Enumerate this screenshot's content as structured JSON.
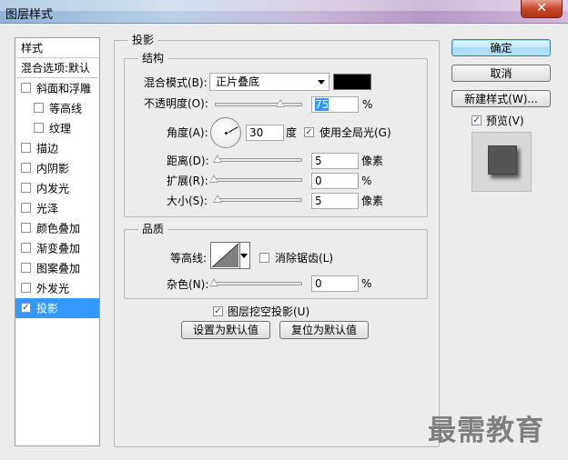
{
  "window": {
    "title": "图层样式",
    "close_glyph": "✕"
  },
  "style_list": {
    "header": "样式",
    "blend_options": "混合选项:默认",
    "items": [
      {
        "label": "斜面和浮雕",
        "checked": false,
        "indent": false
      },
      {
        "label": "等高线",
        "checked": false,
        "indent": true
      },
      {
        "label": "纹理",
        "checked": false,
        "indent": true
      },
      {
        "label": "描边",
        "checked": false,
        "indent": false
      },
      {
        "label": "内阴影",
        "checked": false,
        "indent": false
      },
      {
        "label": "内发光",
        "checked": false,
        "indent": false
      },
      {
        "label": "光泽",
        "checked": false,
        "indent": false
      },
      {
        "label": "颜色叠加",
        "checked": false,
        "indent": false
      },
      {
        "label": "渐变叠加",
        "checked": false,
        "indent": false
      },
      {
        "label": "图案叠加",
        "checked": false,
        "indent": false
      },
      {
        "label": "外发光",
        "checked": false,
        "indent": false
      },
      {
        "label": "投影",
        "checked": true,
        "indent": false,
        "selected": true
      }
    ]
  },
  "drop_shadow": {
    "section_title": "投影",
    "structure": {
      "title": "结构",
      "blend_mode_label": "混合模式(B):",
      "blend_mode_value": "正片叠底",
      "shadow_color": "#000000",
      "opacity_label": "不透明度(O):",
      "opacity_value": "75",
      "opacity_unit": "%",
      "opacity_fraction": 0.75,
      "angle_label": "角度(A):",
      "angle_value": "30",
      "angle_unit": "度",
      "use_global_light_label": "使用全局光(G)",
      "use_global_light_checked": true,
      "distance_label": "距离(D):",
      "distance_value": "5",
      "distance_unit": "像素",
      "spread_label": "扩展(R):",
      "spread_value": "0",
      "spread_unit": "%",
      "size_label": "大小(S):",
      "size_value": "5",
      "size_unit": "像素"
    },
    "quality": {
      "title": "品质",
      "contour_label": "等高线:",
      "anti_aliased_label": "消除锯齿(L)",
      "anti_aliased_checked": false,
      "noise_label": "杂色(N):",
      "noise_value": "0",
      "noise_unit": "%"
    },
    "knockout_label": "图层挖空投影(U)",
    "knockout_checked": true,
    "make_default_label": "设置为默认值",
    "reset_default_label": "复位为默认值"
  },
  "buttons": {
    "ok": "确定",
    "cancel": "取消",
    "new_style": "新建样式(W)..."
  },
  "preview": {
    "label": "预览(V)",
    "checked": true
  },
  "watermark": "最需教育",
  "icons": {
    "close": "close-icon",
    "checkmark": "checkmark-icon",
    "dropdown": "chevron-down-icon",
    "angle_dial": "angle-dial-icon",
    "slider": "slider-thumb-icon"
  }
}
